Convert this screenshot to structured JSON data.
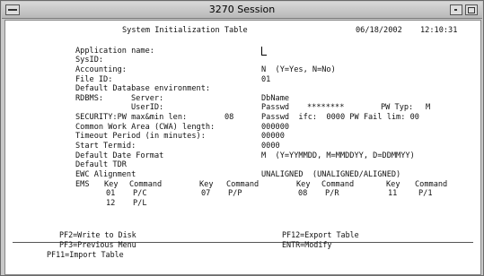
{
  "window": {
    "title": "3270 Session"
  },
  "header": {
    "title": "System Initialization Table",
    "date": "06/18/2002",
    "time": "12:10:31"
  },
  "fields": {
    "app_name": "Application name:",
    "sysid": "SysID:",
    "accounting_label": "Accounting:",
    "accounting_value": "N  (Y=Yes, N=No)",
    "file_id_label": "File ID:",
    "file_id_value": "01",
    "default_db": "Default Database environment:",
    "rdbms_label": "RDBMS:",
    "server_label": "Server:",
    "server_value": "DbName",
    "userid_label": "UserID:",
    "userid_value": "Passwd",
    "passwd_mask": "********",
    "pw_typ_label": "PW Typ:",
    "pw_typ_value": "M",
    "security_label": "SECURITY:PW max&min len:",
    "security_len": "08",
    "security_tail": "Passwd  ifc:  0000 PW Fail lim: 00",
    "cwa_label": "Common Work Area (CWA) length:",
    "cwa_value": "000000",
    "timeout_label": "Timeout Period (in minutes):",
    "timeout_value": "00000",
    "start_termid_label": "Start Termid:",
    "start_termid_value": "0000",
    "date_format_label": "Default Date Format",
    "date_format_value": "M  (Y=YYMMDD, M=MMDDYY, D=DDMMYY)",
    "default_tdr": "Default TDR",
    "ewc_label": "EWC Alignment",
    "ewc_value": "UNALIGNED  (UNALIGNED/ALIGNED)"
  },
  "pf_table": {
    "header": [
      "EMS",
      "Key",
      "Command",
      "Key",
      "Command",
      "Key",
      "Command",
      "Key",
      "Command"
    ],
    "row1": [
      "01",
      "P/C",
      "07",
      "P/P",
      "08",
      "P/R",
      "11",
      "P/1"
    ],
    "row2": [
      "12",
      "P/L"
    ]
  },
  "function_keys": {
    "pf2": "PF2=Write to Disk",
    "pf3": "PF3=Previous Menu",
    "pf11": "PF11=Import Table",
    "pf12": "PF12=Export Table",
    "enter": "ENTR=Modify"
  }
}
